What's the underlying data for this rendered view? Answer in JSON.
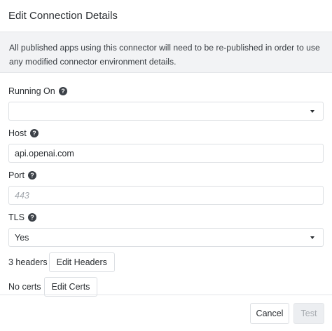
{
  "dialog": {
    "title": "Edit Connection Details",
    "notice": "All published apps using this connector will need to be re-published in order to use any modified connector environment details."
  },
  "fields": {
    "running_on": {
      "label": "Running On",
      "value": ""
    },
    "host": {
      "label": "Host",
      "value": "api.openai.com"
    },
    "port": {
      "label": "Port",
      "value": "",
      "placeholder": "443"
    },
    "tls": {
      "label": "TLS",
      "value": "Yes"
    }
  },
  "headers": {
    "summary": "3 headers",
    "button_label": "Edit Headers"
  },
  "certs": {
    "summary": "No certs",
    "button_label": "Edit Certs"
  },
  "footer": {
    "cancel_label": "Cancel",
    "test_label": "Test"
  },
  "icons": {
    "help": "question-circle-icon",
    "select_caret": "caret-down-icon"
  },
  "colors": {
    "border": "#dcdfe3",
    "notice_bg": "#f2f3f5",
    "text": "#2b2f33",
    "disabled_bg": "#eceef1"
  }
}
